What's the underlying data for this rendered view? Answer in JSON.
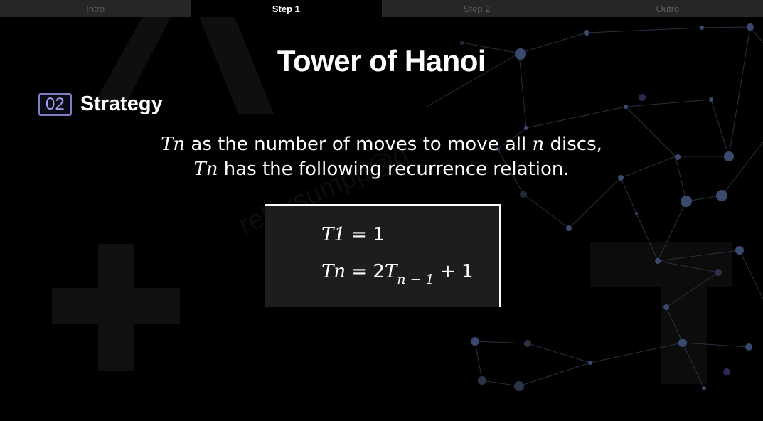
{
  "tabs": [
    {
      "label": "Intro"
    },
    {
      "label": "Step 1"
    },
    {
      "label": "Step 2"
    },
    {
      "label": "Outro"
    }
  ],
  "active_tab": "Step 1",
  "title": "Tower of Hanoi",
  "section": {
    "number": "02",
    "title": "Strategy"
  },
  "description": {
    "line1": {
      "var1": "Tn",
      "text1": " as the number of moves to move all ",
      "var2": "n",
      "text2": " discs,"
    },
    "line2": {
      "var1": "Tn",
      "text1": " has the following recurrence relation."
    }
  },
  "equations": {
    "eq1": {
      "lhs": "T1",
      "rest": " = 1"
    },
    "eq2": {
      "lhs": "Tn",
      "mid": " = 2",
      "t": "T",
      "sub": "n − 1",
      "tail": " + 1"
    }
  },
  "watermark": "relexsumpp@g",
  "colors": {
    "accent": "#7d7ec4",
    "tab_inactive": "#262626",
    "box": "#1d1d1d"
  }
}
